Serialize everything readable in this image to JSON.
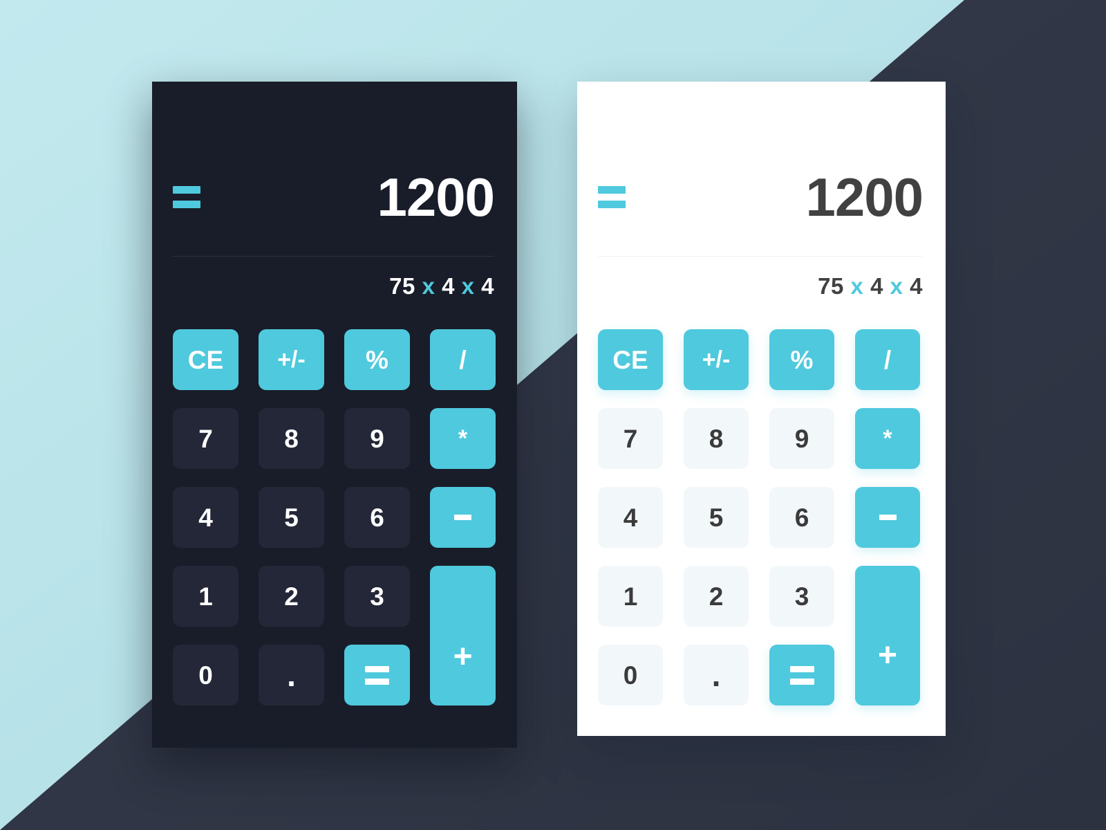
{
  "background": {
    "light_color": "#bee7ed",
    "dark_color": "#333949",
    "split": "diagonal"
  },
  "accent_color": "#4fc9dd",
  "calculators": [
    {
      "theme": "dark",
      "name": "dark-calculator",
      "card_color": "#191d29",
      "key_color": "#232738",
      "text_color": "#ffffff",
      "logo": "equals-logo",
      "display": {
        "result": "1200",
        "expression_parts": [
          {
            "text": "75",
            "type": "operand"
          },
          {
            "text": "x",
            "type": "operator"
          },
          {
            "text": "4",
            "type": "operand"
          },
          {
            "text": "x",
            "type": "operator"
          },
          {
            "text": "4",
            "type": "operand"
          }
        ],
        "expression": "75 x 4 x 4"
      },
      "keys": [
        {
          "label": "CE",
          "name": "clear-entry-key",
          "style": "accent"
        },
        {
          "label": "+/-",
          "name": "sign-toggle-key",
          "style": "accent"
        },
        {
          "label": "%",
          "name": "percent-key",
          "style": "accent"
        },
        {
          "label": "/",
          "name": "divide-key",
          "style": "accent"
        },
        {
          "label": "7",
          "name": "digit-7-key",
          "style": "num"
        },
        {
          "label": "8",
          "name": "digit-8-key",
          "style": "num"
        },
        {
          "label": "9",
          "name": "digit-9-key",
          "style": "num"
        },
        {
          "label": "*",
          "name": "multiply-key",
          "style": "accent"
        },
        {
          "label": "4",
          "name": "digit-4-key",
          "style": "num"
        },
        {
          "label": "5",
          "name": "digit-5-key",
          "style": "num"
        },
        {
          "label": "6",
          "name": "digit-6-key",
          "style": "num"
        },
        {
          "label": "-",
          "name": "subtract-key",
          "style": "accent"
        },
        {
          "label": "1",
          "name": "digit-1-key",
          "style": "num"
        },
        {
          "label": "2",
          "name": "digit-2-key",
          "style": "num"
        },
        {
          "label": "3",
          "name": "digit-3-key",
          "style": "num"
        },
        {
          "label": "+",
          "name": "add-key",
          "style": "accent"
        },
        {
          "label": "0",
          "name": "digit-0-key",
          "style": "num"
        },
        {
          "label": ".",
          "name": "decimal-point-key",
          "style": "num"
        },
        {
          "label": "=",
          "name": "equals-key",
          "style": "accent"
        }
      ]
    },
    {
      "theme": "light",
      "name": "light-calculator",
      "card_color": "#ffffff",
      "key_color": "#f2f7fa",
      "text_color": "#414141",
      "logo": "equals-logo",
      "display": {
        "result": "1200",
        "expression_parts": [
          {
            "text": "75",
            "type": "operand"
          },
          {
            "text": "x",
            "type": "operator"
          },
          {
            "text": "4",
            "type": "operand"
          },
          {
            "text": "x",
            "type": "operator"
          },
          {
            "text": "4",
            "type": "operand"
          }
        ],
        "expression": "75 x 4 x 4"
      },
      "keys": [
        {
          "label": "CE",
          "name": "clear-entry-key",
          "style": "accent"
        },
        {
          "label": "+/-",
          "name": "sign-toggle-key",
          "style": "accent"
        },
        {
          "label": "%",
          "name": "percent-key",
          "style": "accent"
        },
        {
          "label": "/",
          "name": "divide-key",
          "style": "accent"
        },
        {
          "label": "7",
          "name": "digit-7-key",
          "style": "num"
        },
        {
          "label": "8",
          "name": "digit-8-key",
          "style": "num"
        },
        {
          "label": "9",
          "name": "digit-9-key",
          "style": "num"
        },
        {
          "label": "*",
          "name": "multiply-key",
          "style": "accent"
        },
        {
          "label": "4",
          "name": "digit-4-key",
          "style": "num"
        },
        {
          "label": "5",
          "name": "digit-5-key",
          "style": "num"
        },
        {
          "label": "6",
          "name": "digit-6-key",
          "style": "num"
        },
        {
          "label": "-",
          "name": "subtract-key",
          "style": "accent"
        },
        {
          "label": "1",
          "name": "digit-1-key",
          "style": "num"
        },
        {
          "label": "2",
          "name": "digit-2-key",
          "style": "num"
        },
        {
          "label": "3",
          "name": "digit-3-key",
          "style": "num"
        },
        {
          "label": "+",
          "name": "add-key",
          "style": "accent"
        },
        {
          "label": "0",
          "name": "digit-0-key",
          "style": "num"
        },
        {
          "label": ".",
          "name": "decimal-point-key",
          "style": "num"
        },
        {
          "label": "=",
          "name": "equals-key",
          "style": "accent"
        }
      ]
    }
  ]
}
